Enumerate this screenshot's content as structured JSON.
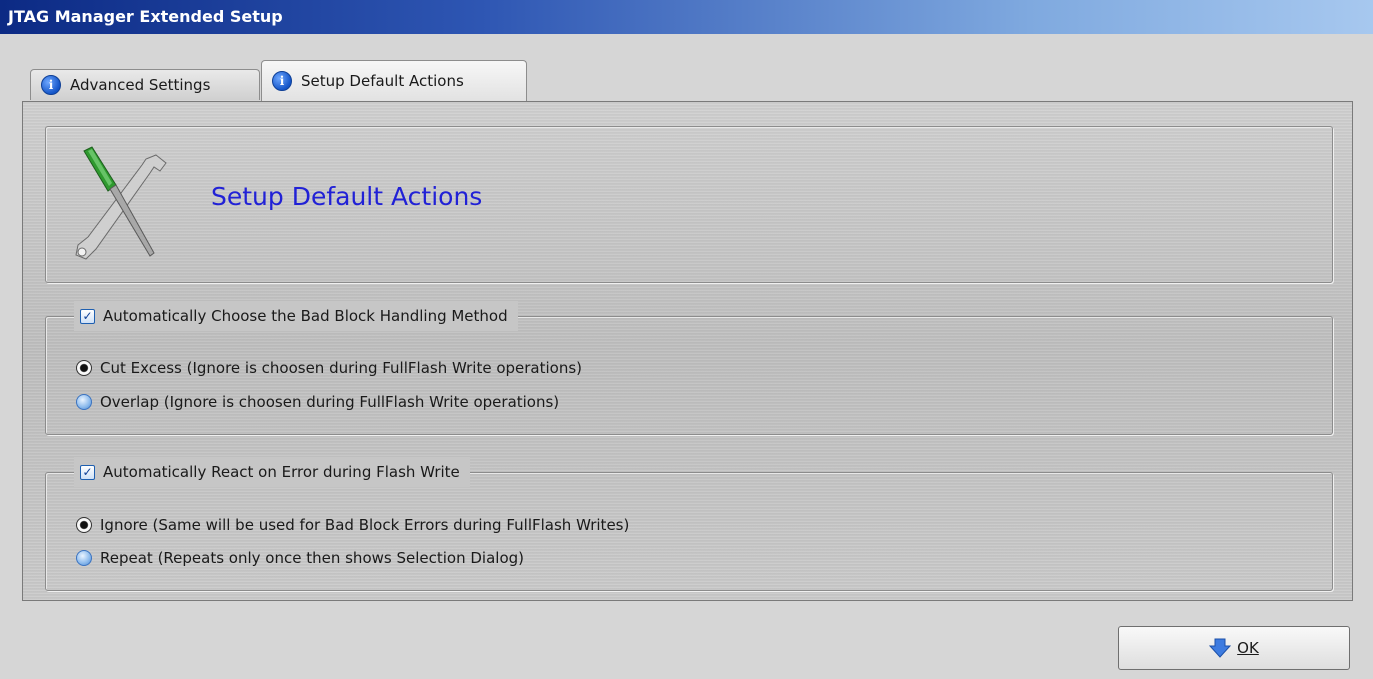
{
  "window": {
    "title": "JTAG Manager Extended Setup"
  },
  "tabs": [
    {
      "label": "Advanced Settings",
      "active": false,
      "icon": "info-icon"
    },
    {
      "label": "Setup Default Actions",
      "active": true,
      "icon": "info-icon"
    }
  ],
  "header": {
    "title": "Setup Default Actions",
    "icon": "tools-icon"
  },
  "bad_block_group": {
    "label": "Automatically Choose the Bad Block Handling Method",
    "checked": true,
    "options": [
      {
        "label": "Cut Excess (Ignore is choosen during FullFlash Write operations)",
        "selected": true
      },
      {
        "label": "Overlap (Ignore is choosen during FullFlash Write operations)",
        "selected": false
      }
    ]
  },
  "error_group": {
    "label": "Automatically React on Error during Flash Write",
    "checked": true,
    "options": [
      {
        "label": "Ignore (Same will be used for Bad Block Errors during FullFlash Writes)",
        "selected": true
      },
      {
        "label": "Repeat (Repeats only once then shows Selection Dialog)",
        "selected": false
      }
    ]
  },
  "footer": {
    "ok_label": "OK",
    "ok_icon": "down-arrow-icon"
  },
  "colors": {
    "title_bar_start": "#0c2a84",
    "title_bar_end": "#a7c8ef",
    "header_text": "#2121d6"
  }
}
